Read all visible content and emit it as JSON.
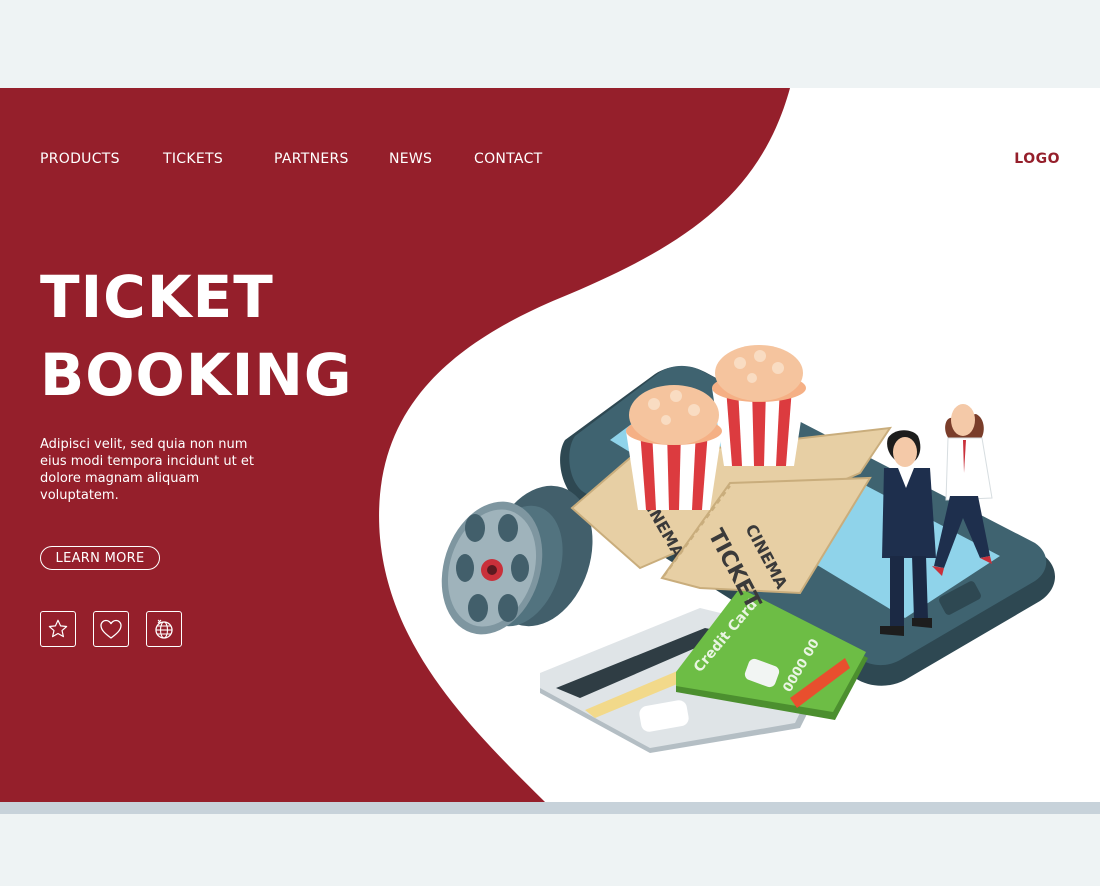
{
  "colors": {
    "brand_red": "#951f2b",
    "background": "#eef3f4",
    "white": "#ffffff",
    "phone": "#36535e",
    "screen": "#8fd3ea",
    "ticket": "#e7cfa4",
    "card_green": "#6dbd45"
  },
  "nav": {
    "items": [
      {
        "label": "PRODUCTS"
      },
      {
        "label": "TICKETS"
      },
      {
        "label": "PARTNERS"
      },
      {
        "label": "NEWS"
      },
      {
        "label": "CONTACT"
      }
    ],
    "logo": "LOGO"
  },
  "hero": {
    "title_line1": "TICKET",
    "title_line2": "BOOKING",
    "body": "Adipisci velit, sed quia non num eius modi tempora incidunt ut et dolore magnam aliquam voluptatem.",
    "cta_label": "LEARN MORE"
  },
  "icons": [
    {
      "name": "star-icon"
    },
    {
      "name": "heart-icon"
    },
    {
      "name": "globe-icon"
    }
  ],
  "illustration": {
    "ticket_front_text1": "CINEMA",
    "ticket_front_text2": "TICKET",
    "ticket_back_text": "CINEMA",
    "card_label": "Credit Card",
    "card_number": "0000 00"
  }
}
